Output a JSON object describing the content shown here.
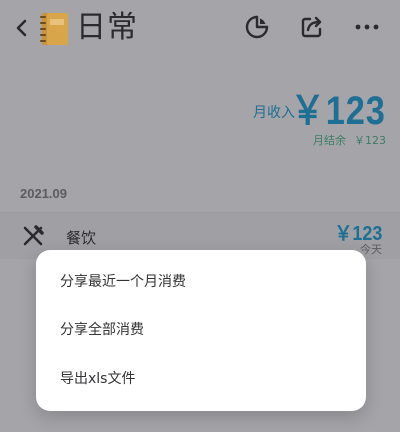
{
  "header": {
    "title": "日常"
  },
  "summary": {
    "income_label": "月收入",
    "income_value": "￥123",
    "balance_label": "月结余",
    "balance_value": "￥123"
  },
  "records": {
    "month": "2021.09",
    "items": [
      {
        "category": "餐饮",
        "amount": "￥123",
        "date": "今天"
      }
    ]
  },
  "share_menu": {
    "items": [
      {
        "label": "分享最近一个月消费"
      },
      {
        "label": "分享全部消费"
      },
      {
        "label": "导出xls文件"
      }
    ]
  },
  "colors": {
    "accent": "#1e6f94",
    "balance": "#3c7d62",
    "overlay_background": "#a5a5a9"
  }
}
